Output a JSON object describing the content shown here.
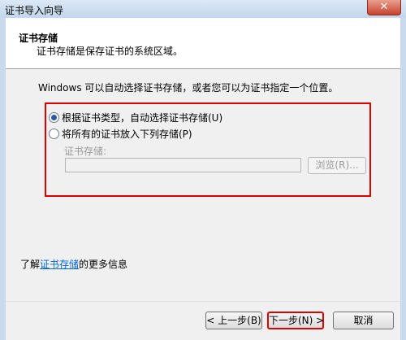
{
  "window": {
    "title": "证书导入向导",
    "close_glyph": "✕"
  },
  "header": {
    "title": "证书存储",
    "subtitle": "证书存储是保存证书的系统区域。"
  },
  "intro": "Windows 可以自动选择证书存储，或者您可以为证书指定一个位置。",
  "options": [
    {
      "label": "根据证书类型，自动选择证书存储(U)",
      "selected": true
    },
    {
      "label": "将所有的证书放入下列存储(P)",
      "selected": false
    }
  ],
  "store": {
    "label": "证书存储:",
    "value": "",
    "browse_label": "浏览(R)..."
  },
  "learn_more": {
    "prefix": "了解",
    "link": "证书存储",
    "suffix": "的更多信息"
  },
  "buttons": {
    "back": "< 上一步(B)",
    "next": "下一步(N) >",
    "cancel": "取消"
  },
  "colors": {
    "highlight": "#e00000",
    "link": "#0066cc"
  }
}
